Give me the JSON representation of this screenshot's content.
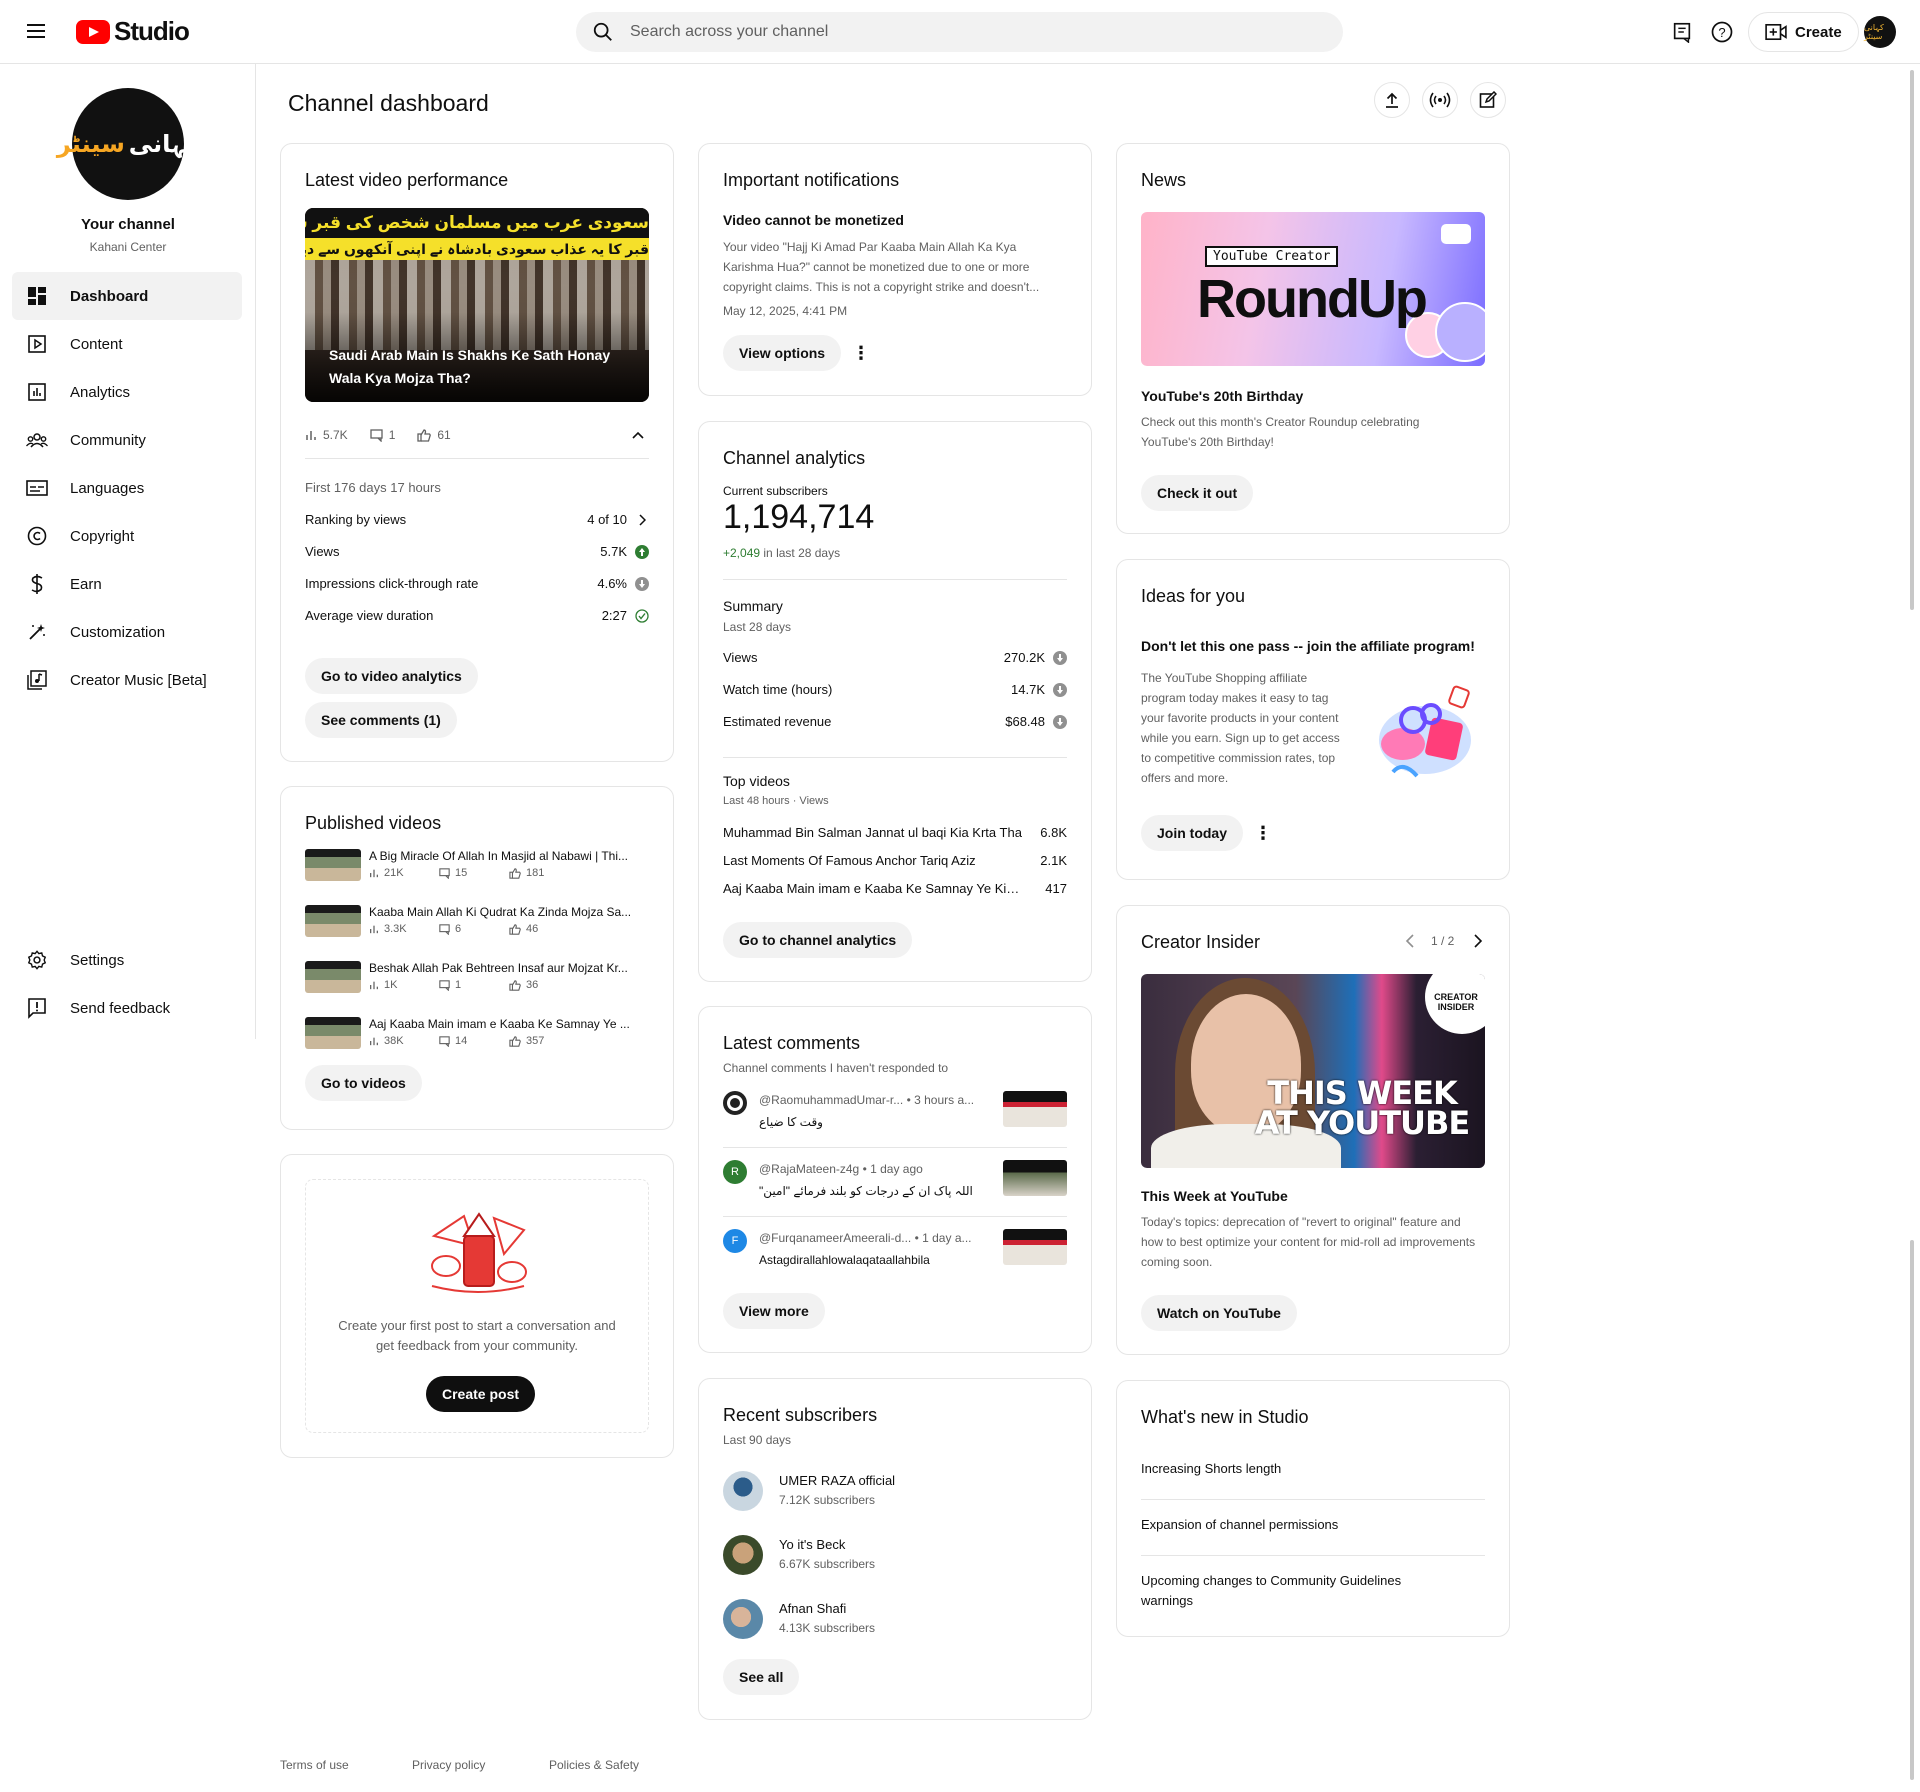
{
  "header": {
    "logo_text": "Studio",
    "search_placeholder": "Search across your channel",
    "create_label": "Create",
    "avatar_text": "کہانی سینٹر"
  },
  "sidebar": {
    "channel_avatar_text1": "کہانی",
    "channel_avatar_text2": "سینٹر",
    "channel_name": "Your channel",
    "channel_handle": "Kahani Center",
    "items": [
      {
        "label": "Dashboard",
        "icon": "dashboard-icon",
        "active": true
      },
      {
        "label": "Content",
        "icon": "content-icon"
      },
      {
        "label": "Analytics",
        "icon": "analytics-icon"
      },
      {
        "label": "Community",
        "icon": "community-icon"
      },
      {
        "label": "Languages",
        "icon": "languages-icon"
      },
      {
        "label": "Copyright",
        "icon": "copyright-icon"
      },
      {
        "label": "Earn",
        "icon": "earn-icon"
      },
      {
        "label": "Customization",
        "icon": "customization-icon"
      },
      {
        "label": "Creator Music [Beta]",
        "icon": "creator-music-icon"
      }
    ],
    "bottom_items": [
      {
        "label": "Settings",
        "icon": "gear-icon"
      },
      {
        "label": "Send feedback",
        "icon": "feedback-icon"
      }
    ]
  },
  "main": {
    "page_title": "Channel dashboard"
  },
  "latest_video": {
    "title": "Latest video performance",
    "thumb_urdu_line1": "سعودی عرب میں مسلمان شخص کی قبر سے سانپ ہی سانپ نکل آئے",
    "thumb_urdu_line2": "قبر کا یہ عذاب سعودی بادشاہ نے اپنی آنکھوں سے دیکھا تو کیا کیا؟",
    "thumb_caption": "Saudi Arab Main Is Shakhs Ke Sath Honay Wala Kya Mojza Tha?",
    "stat_views": "5.7K",
    "stat_comments": "1",
    "stat_likes": "61",
    "period": "First 176 days 17 hours",
    "rows": [
      {
        "label": "Ranking by views",
        "value": "4 of 10"
      },
      {
        "label": "Views",
        "value": "5.7K"
      },
      {
        "label": "Impressions click-through rate",
        "value": "4.6%"
      },
      {
        "label": "Average view duration",
        "value": "2:27"
      }
    ],
    "btn_analytics": "Go to video analytics",
    "btn_comments": "See comments (1)"
  },
  "published": {
    "title": "Published videos",
    "videos": [
      {
        "title": "A Big Miracle Of Allah In Masjid al Nabawi | Thi...",
        "views": "21K",
        "comments": "15",
        "likes": "181"
      },
      {
        "title": "Kaaba Main Allah Ki Qudrat Ka Zinda Mojza Sa...",
        "views": "3.3K",
        "comments": "6",
        "likes": "46"
      },
      {
        "title": "Beshak Allah Pak Behtreen Insaf aur Mojzat Kr...",
        "views": "1K",
        "comments": "1",
        "likes": "36"
      },
      {
        "title": "Aaj Kaaba Main imam e Kaaba Ke Samnay Ye ...",
        "views": "38K",
        "comments": "14",
        "likes": "357"
      }
    ],
    "btn": "Go to videos"
  },
  "create_post": {
    "text": "Create your first post to start a conversation and get feedback from your community.",
    "btn": "Create post"
  },
  "notifications": {
    "title": "Important notifications",
    "heading": "Video cannot be monetized",
    "body": "Your video \"Hajj Ki Amad Par Kaaba Main Allah Ka Kya Karishma Hua?\" cannot be monetized due to one or more copyright claims. This is not a copyright strike and doesn't...",
    "date": "May 12, 2025, 4:41 PM",
    "btn": "View options"
  },
  "analytics": {
    "title": "Channel analytics",
    "subs_label": "Current subscribers",
    "subs_value": "1,194,714",
    "subs_change": "+2,049",
    "subs_change_suffix": "in last 28 days",
    "summary_title": "Summary",
    "summary_period": "Last 28 days",
    "summary_rows": [
      {
        "label": "Views",
        "value": "270.2K"
      },
      {
        "label": "Watch time (hours)",
        "value": "14.7K"
      },
      {
        "label": "Estimated revenue",
        "value": "$68.48"
      }
    ],
    "top_title": "Top videos",
    "top_period": "Last 48 hours · Views",
    "top_videos": [
      {
        "title": "Muhammad Bin Salman Jannat ul baqi Kia Krta Tha",
        "value": "6.8K"
      },
      {
        "title": "Last Moments Of Famous Anchor Tariq Aziz",
        "value": "2.1K"
      },
      {
        "title": "Aaj Kaaba Main imam e Kaaba Ke Samnay Ye Kia H...",
        "value": "417"
      }
    ],
    "btn": "Go to channel analytics"
  },
  "comments": {
    "title": "Latest comments",
    "subtitle": "Channel comments I haven't responded to",
    "items": [
      {
        "author": "@RaomuhammadUmar-r...",
        "time": "• 3 hours a...",
        "text": "وقت کا ضیاع",
        "avatar": "",
        "color": "#222222"
      },
      {
        "author": "@RajaMateen-z4g",
        "time": "• 1 day ago",
        "text": "\"اللہ پاک ان کے درجات کو بلند فرمائے \"امین",
        "avatar": "R",
        "color": "#2e7d32"
      },
      {
        "author": "@FurqanameerAmeerali-d...",
        "time": "• 1 day a...",
        "text": "Astagdirallahlowalaqataallahbila",
        "avatar": "F",
        "color": "#1e88e5"
      }
    ],
    "btn": "View more"
  },
  "subscribers": {
    "title": "Recent subscribers",
    "period": "Last 90 days",
    "items": [
      {
        "name": "UMER RAZA official",
        "count": "7.12K subscribers"
      },
      {
        "name": "Yo it's Beck",
        "count": "6.67K subscribers"
      },
      {
        "name": "Afnan Shafi",
        "count": "4.13K subscribers"
      }
    ],
    "btn": "See all"
  },
  "news": {
    "title": "News",
    "img_tag": "YouTube Creator",
    "img_text": "RoundUp",
    "heading": "YouTube's 20th Birthday",
    "body": "Check out this month's Creator Roundup celebrating YouTube's 20th Birthday!",
    "btn": "Check it out"
  },
  "ideas": {
    "title": "Ideas for you",
    "heading": "Don't let this one pass -- join the affiliate program!",
    "body": "The YouTube Shopping affiliate program today makes it easy to tag your favorite products in your content while you earn. Sign up to get access to competitive commission rates, top offers and more.",
    "btn": "Join today"
  },
  "insider": {
    "title": "Creator Insider",
    "pager": "1 / 2",
    "img_text": "THIS WEEK AT YOUTUBE",
    "img_badge": "CREATOR INSIDER",
    "heading": "This Week at YouTube",
    "body": "Today's topics: deprecation of \"revert to original\" feature and how to best optimize your content for mid-roll ad improvements coming soon.",
    "btn": "Watch on YouTube"
  },
  "whats_new": {
    "title": "What's new in Studio",
    "items": [
      "Increasing Shorts length",
      "Expansion of channel permissions",
      "Upcoming changes to Community Guidelines warnings"
    ]
  },
  "footer": {
    "links": [
      "Terms of use",
      "Privacy policy",
      "Policies & Safety"
    ]
  },
  "colors": {
    "brand_red": "#ff0000",
    "positive_green": "#2e7d32",
    "text_muted": "#606060"
  }
}
